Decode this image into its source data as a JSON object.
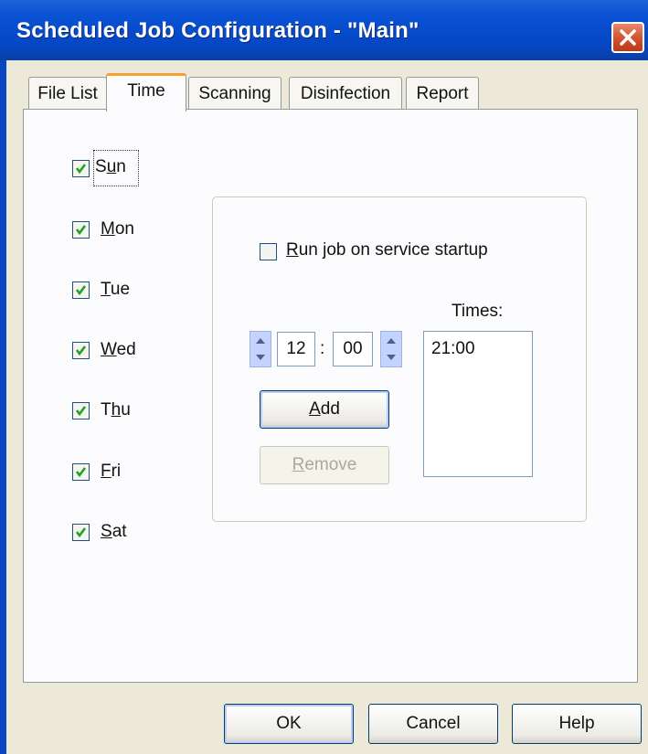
{
  "window": {
    "title": "Scheduled Job Configuration - \"Main\""
  },
  "tabs": [
    {
      "label": "File List",
      "active": false
    },
    {
      "label": "Time",
      "active": true
    },
    {
      "label": "Scanning",
      "active": false
    },
    {
      "label": "Disinfection",
      "active": false
    },
    {
      "label": "Report",
      "active": false
    }
  ],
  "days": [
    {
      "prefix": "S",
      "accel": "u",
      "suffix": "n",
      "checked": true
    },
    {
      "prefix": "",
      "accel": "M",
      "suffix": "on",
      "checked": true
    },
    {
      "prefix": "",
      "accel": "T",
      "suffix": "ue",
      "checked": true
    },
    {
      "prefix": "",
      "accel": "W",
      "suffix": "ed",
      "checked": true
    },
    {
      "prefix": "T",
      "accel": "h",
      "suffix": "u",
      "checked": true
    },
    {
      "prefix": "",
      "accel": "F",
      "suffix": "ri",
      "checked": true
    },
    {
      "prefix": "",
      "accel": "S",
      "suffix": "at",
      "checked": true
    }
  ],
  "run_on_startup": {
    "prefix": "",
    "accel": "R",
    "suffix": "un job on service startup",
    "checked": false
  },
  "time": {
    "hour": "12",
    "separator": ":",
    "minute": "00",
    "times_label": "Times:",
    "times": [
      "21:00"
    ]
  },
  "buttons": {
    "add": {
      "prefix": "",
      "accel": "A",
      "suffix": "dd"
    },
    "remove": {
      "prefix": "",
      "accel": "R",
      "suffix": "emove",
      "disabled": true
    },
    "ok": "OK",
    "cancel": "Cancel",
    "help": "Help"
  },
  "icons": {
    "close": "close-icon",
    "check": "checkmark-icon",
    "spin_up": "arrow-up-icon",
    "spin_down": "arrow-down-icon"
  },
  "colors": {
    "titlebar": "#0a52d4",
    "tab_highlight": "#f2a22f",
    "checkmark": "#21a121",
    "close_button": "#d1512c"
  }
}
